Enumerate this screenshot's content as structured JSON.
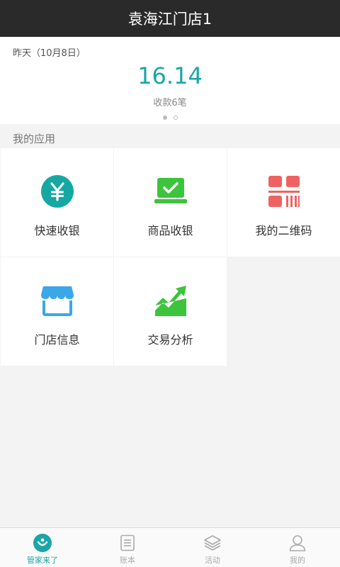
{
  "header": {
    "title": "袁海江门店1"
  },
  "summary": {
    "date": "昨天（10月8日）",
    "amount": "16.14",
    "count": "收款6笔"
  },
  "apps_section": {
    "label": "我的应用"
  },
  "apps": [
    {
      "label": "快速收银",
      "icon": "yen-icon",
      "color": "#15a8a3"
    },
    {
      "label": "商品收银",
      "icon": "laptop-check-icon",
      "color": "#3cc43c"
    },
    {
      "label": "我的二维码",
      "icon": "qrcode-icon",
      "color": "#f06262"
    },
    {
      "label": "门店信息",
      "icon": "store-icon",
      "color": "#3aa7e8"
    },
    {
      "label": "交易分析",
      "icon": "chart-up-icon",
      "color": "#3cc43c"
    }
  ],
  "tabs": [
    {
      "label": "管家来了",
      "icon": "home-logo-icon",
      "active": true
    },
    {
      "label": "账本",
      "icon": "ledger-icon",
      "active": false
    },
    {
      "label": "活动",
      "icon": "layers-icon",
      "active": false
    },
    {
      "label": "我的",
      "icon": "user-icon",
      "active": false
    }
  ],
  "colors": {
    "accent": "#1aa6a6",
    "header_bg": "#2a2a2a"
  }
}
